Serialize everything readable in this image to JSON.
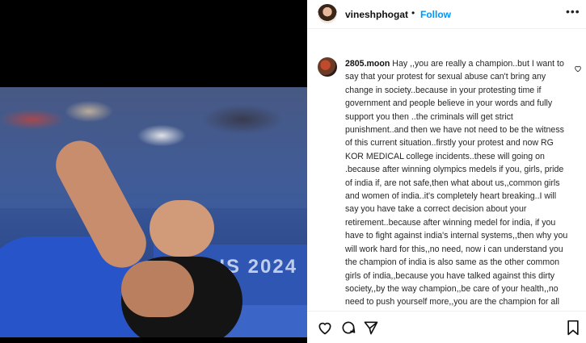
{
  "header": {
    "username": "vineshphogat",
    "separator": "•",
    "follow_label": "Follow",
    "more_icon": "more-options-icon"
  },
  "photo": {
    "banner_text": "RIS 2024"
  },
  "comment": {
    "author": "2805.moon",
    "text": "Hay ,,you are really a champion..but I want to say that your protest for sexual abuse can't bring any change in society..because in your protesting time if government and people believe in your words and fully support you then ..the criminals will get strict punishment..and then we have not need to be the witness of this current situation..firstly your protest and now RG KOR MEDICAL college incidents..these will going on .because after winning olympics medels if you, girls, pride of india if, are not safe,then what about us,,common girls and women of india..it's completely heart breaking..I will say you have take a correct decision about your retirement..because after winning medel for india, if you have to fight against india's internal systems,,then why you will work hard for this,,no need, now i can understand you the champion of india is also same as the other common girls of india,,because you have talked against this dirty society,,by the way champion,,be care of your health,,no need to push yourself more,,you are the champion for all the girls of india ❤️❤️❤️❤️❤️"
  },
  "icons": {
    "like": "heart-icon",
    "comment": "comment-icon",
    "share": "share-icon",
    "save": "bookmark-icon"
  }
}
